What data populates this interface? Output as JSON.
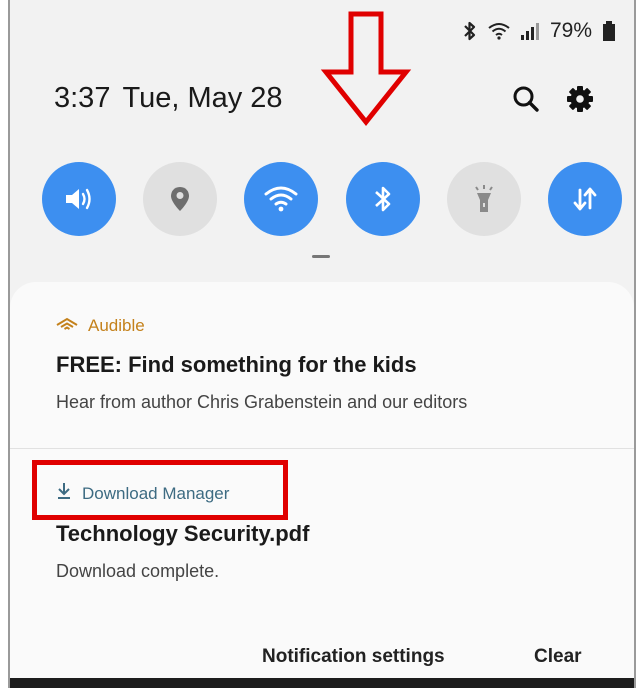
{
  "status_bar": {
    "battery": "79%",
    "icons": [
      "bluetooth-icon",
      "wifi-icon",
      "signal-icon",
      "battery-icon"
    ]
  },
  "header": {
    "time": "3:37",
    "date": "Tue, May 28"
  },
  "quick_settings": [
    {
      "name": "sound",
      "icon": "sound-icon",
      "state": "on"
    },
    {
      "name": "location",
      "icon": "location-icon",
      "state": "off"
    },
    {
      "name": "wifi",
      "icon": "wifi-icon",
      "state": "on"
    },
    {
      "name": "bluetooth",
      "icon": "bluetooth-icon",
      "state": "on"
    },
    {
      "name": "flashlight",
      "icon": "flashlight-icon",
      "state": "off"
    },
    {
      "name": "mobile-data",
      "icon": "data-transfer-icon",
      "state": "on"
    }
  ],
  "notifications": [
    {
      "app": "Audible",
      "title": "FREE: Find something for the kids",
      "body": "Hear from author Chris Grabenstein and our editors"
    },
    {
      "app": "Download Manager",
      "title": "Technology Security.pdf",
      "body": "Download complete."
    }
  ],
  "footer": {
    "settings_label": "Notification settings",
    "clear_label": "Clear"
  },
  "colors": {
    "accent": "#3d8ff0",
    "annotation_red": "#e00000",
    "audible_orange": "#c4811b"
  }
}
